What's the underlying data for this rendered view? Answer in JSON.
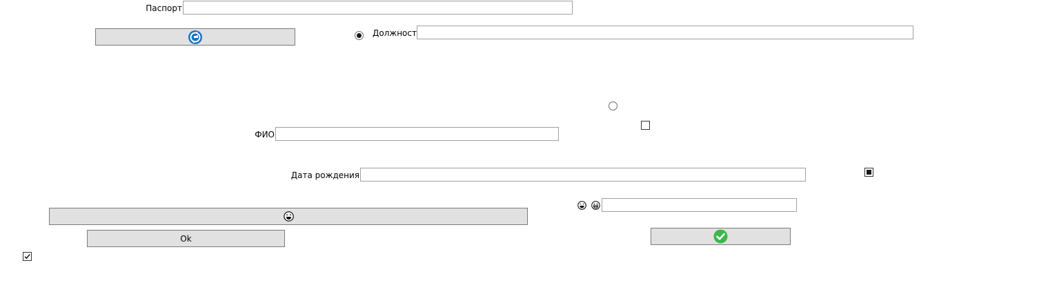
{
  "form": {
    "passport_label": "Паспорт",
    "passport_value": "",
    "position_label": "Должность",
    "position_value": "",
    "fio_label": "ФИО",
    "fio_value": "",
    "birthdate_label": "Дата рождения",
    "birthdate_value": "",
    "emoji_field_value": ""
  },
  "buttons": {
    "ok_label": "Ok",
    "refresh_icon": "refresh-icon",
    "laugh_icon": "laughing-face-icon",
    "confirm_icon": "check-circle-icon"
  },
  "controls": {
    "radio_position_checked": true,
    "radio_empty_checked": false,
    "checkbox_mid_checked": false,
    "checkbox_indeterminate": true,
    "checkbox_bottom_checked": true
  },
  "colors": {
    "refresh_blue": "#1a73c7",
    "confirm_green": "#3cb84a",
    "button_bg": "#e1e1e1",
    "border": "#a0a0a0"
  }
}
